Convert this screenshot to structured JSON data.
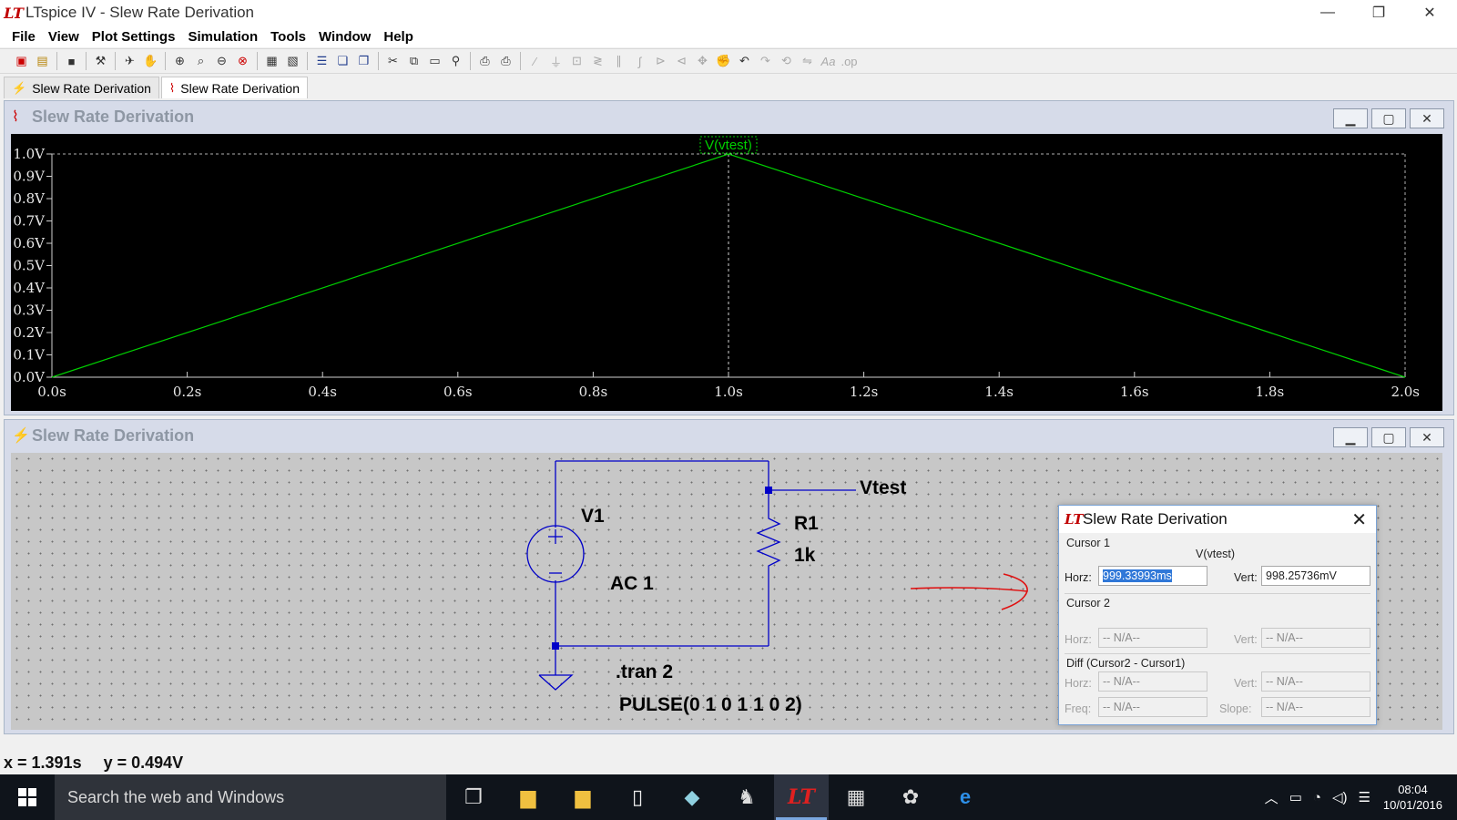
{
  "window": {
    "title": "LTspice IV - Slew Rate Derivation",
    "controls": [
      "—",
      "❐",
      "✕"
    ]
  },
  "menubar": [
    "File",
    "View",
    "Plot Settings",
    "Simulation",
    "Tools",
    "Window",
    "Help"
  ],
  "tabs": [
    {
      "label": "Slew Rate Derivation",
      "icon": "schematic-icon",
      "active": false
    },
    {
      "label": "Slew Rate Derivation",
      "icon": "waveform-icon",
      "active": true
    }
  ],
  "plot_window": {
    "title": "Slew Rate Derivation",
    "trace_label": "V(vtest)",
    "trace_color": "#00d000"
  },
  "chart_data": {
    "type": "line",
    "title": "",
    "xlabel": "",
    "ylabel": "",
    "xlim": [
      0.0,
      2.0
    ],
    "ylim": [
      0.0,
      1.0
    ],
    "x_ticks": [
      "0.0s",
      "0.2s",
      "0.4s",
      "0.6s",
      "0.8s",
      "1.0s",
      "1.2s",
      "1.4s",
      "1.6s",
      "1.8s",
      "2.0s"
    ],
    "y_ticks": [
      "0.0V",
      "0.1V",
      "0.2V",
      "0.3V",
      "0.4V",
      "0.5V",
      "0.6V",
      "0.7V",
      "0.8V",
      "0.9V",
      "1.0V"
    ],
    "series": [
      {
        "name": "V(vtest)",
        "x": [
          0.0,
          1.0,
          2.0
        ],
        "y": [
          0.0,
          1.0,
          0.0
        ],
        "color": "#00d000"
      }
    ],
    "cursor_x": 1.0,
    "background": "#000000",
    "grid": false
  },
  "schematic_window": {
    "title": "Slew Rate Derivation",
    "source_name": "V1",
    "source_value": "AC 1",
    "resistor_name": "R1",
    "resistor_value": "1k",
    "net_label": "Vtest",
    "directive_1": ".tran 2",
    "directive_2": "PULSE(0 1 0 1 1 0 2)",
    "wire_color": "#0000c8"
  },
  "cursor_dialog": {
    "title": "Slew Rate Derivation",
    "cursor1_label": "Cursor 1",
    "trace": "V(vtest)",
    "horz_label": "Horz:",
    "vert_label": "Vert:",
    "horz1": "999.33993ms",
    "vert1": "998.25736mV",
    "cursor2_label": "Cursor 2",
    "horz2": "-- N/A--",
    "vert2": "-- N/A--",
    "diff_label": "Diff (Cursor2 - Cursor1)",
    "diff_horz": "-- N/A--",
    "diff_vert": "-- N/A--",
    "freq_label": "Freq:",
    "slope_label": "Slope:",
    "freq": "-- N/A--",
    "slope": "-- N/A--"
  },
  "statusbar": {
    "x": "x = 1.391s",
    "y": "y = 0.494V"
  },
  "taskbar": {
    "search_placeholder": "Search the web and Windows",
    "time": "08:04",
    "date": "10/01/2016"
  }
}
